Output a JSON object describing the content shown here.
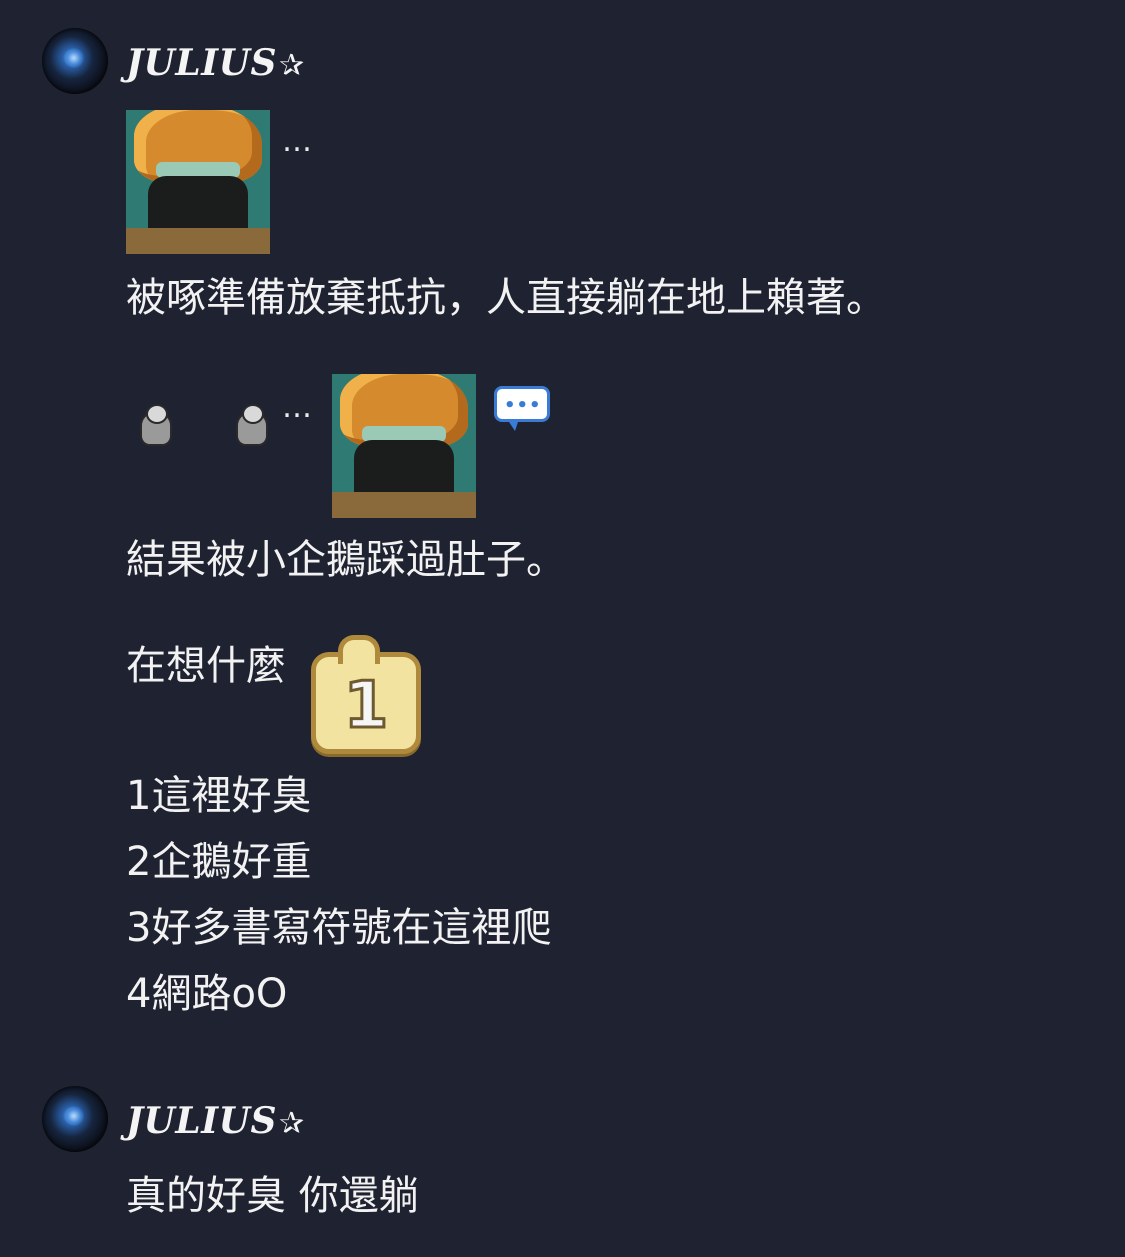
{
  "messages": [
    {
      "author": "JULIUS",
      "author_symbol": "✰",
      "sticker_caption": "…",
      "text_1": "被啄準備放棄抵抗，人直接躺在地上賴著。",
      "emoji_row_dots": "…",
      "chat_bubble_dots": "•••",
      "text_2": "結果被小企鵝踩過肚子。",
      "question": "在想什麼",
      "badge_number": "1",
      "options": [
        "1這裡好臭",
        "2企鵝好重",
        "3好多書寫符號在這裡爬",
        "4網路oO"
      ]
    },
    {
      "author": "JULIUS",
      "author_symbol": "✰",
      "text": "真的好臭 你還躺"
    }
  ],
  "icons": [
    "penguin-icon",
    "penguin-icon",
    "chat-bubble-icon",
    "number-badge-icon"
  ],
  "colors": {
    "background": "#1f2230",
    "text": "#f2f2f2"
  }
}
